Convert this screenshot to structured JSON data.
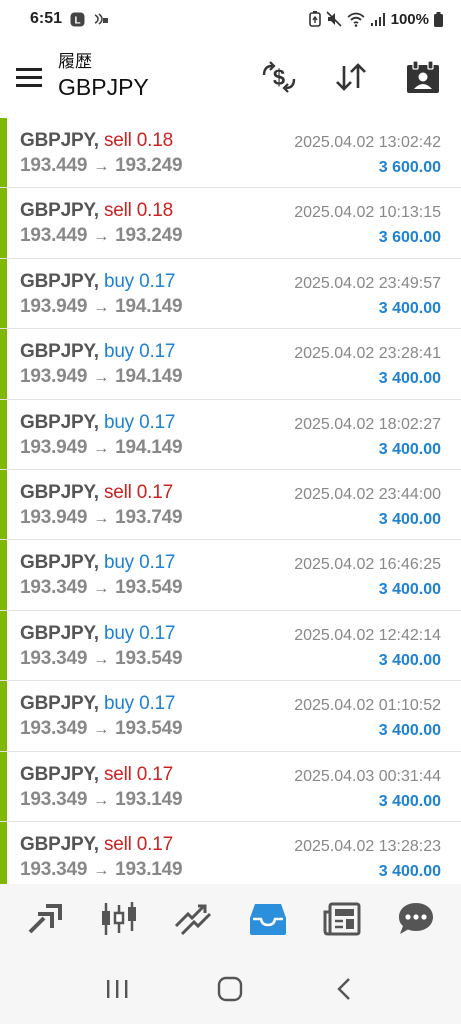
{
  "status_bar": {
    "time": "6:51",
    "battery": "100%",
    "icons": [
      "l-badge-icon",
      "nfc-icon",
      "battery-saver-icon",
      "mute-icon",
      "wifi-icon",
      "signal-icon",
      "battery-icon"
    ]
  },
  "header": {
    "subtitle": "履歴",
    "symbol": "GBPJPY",
    "actions": [
      "currency-exchange-icon",
      "sort-icon",
      "profile-calendar-icon"
    ]
  },
  "trades": [
    {
      "symbol": "GBPJPY,",
      "side": "sell",
      "volume": "0.18",
      "open": "193.449",
      "close": "193.249",
      "datetime": "2025.04.02 13:02:42",
      "profit": "3 600.00"
    },
    {
      "symbol": "GBPJPY,",
      "side": "sell",
      "volume": "0.18",
      "open": "193.449",
      "close": "193.249",
      "datetime": "2025.04.02 10:13:15",
      "profit": "3 600.00"
    },
    {
      "symbol": "GBPJPY,",
      "side": "buy",
      "volume": "0.17",
      "open": "193.949",
      "close": "194.149",
      "datetime": "2025.04.02 23:49:57",
      "profit": "3 400.00"
    },
    {
      "symbol": "GBPJPY,",
      "side": "buy",
      "volume": "0.17",
      "open": "193.949",
      "close": "194.149",
      "datetime": "2025.04.02 23:28:41",
      "profit": "3 400.00"
    },
    {
      "symbol": "GBPJPY,",
      "side": "buy",
      "volume": "0.17",
      "open": "193.949",
      "close": "194.149",
      "datetime": "2025.04.02 18:02:27",
      "profit": "3 400.00"
    },
    {
      "symbol": "GBPJPY,",
      "side": "sell",
      "volume": "0.17",
      "open": "193.949",
      "close": "193.749",
      "datetime": "2025.04.02 23:44:00",
      "profit": "3 400.00"
    },
    {
      "symbol": "GBPJPY,",
      "side": "buy",
      "volume": "0.17",
      "open": "193.349",
      "close": "193.549",
      "datetime": "2025.04.02 16:46:25",
      "profit": "3 400.00"
    },
    {
      "symbol": "GBPJPY,",
      "side": "buy",
      "volume": "0.17",
      "open": "193.349",
      "close": "193.549",
      "datetime": "2025.04.02 12:42:14",
      "profit": "3 400.00"
    },
    {
      "symbol": "GBPJPY,",
      "side": "buy",
      "volume": "0.17",
      "open": "193.349",
      "close": "193.549",
      "datetime": "2025.04.02 01:10:52",
      "profit": "3 400.00"
    },
    {
      "symbol": "GBPJPY,",
      "side": "sell",
      "volume": "0.17",
      "open": "193.349",
      "close": "193.149",
      "datetime": "2025.04.03 00:31:44",
      "profit": "3 400.00"
    },
    {
      "symbol": "GBPJPY,",
      "side": "sell",
      "volume": "0.17",
      "open": "193.349",
      "close": "193.149",
      "datetime": "2025.04.02 13:28:23",
      "profit": "3 400.00"
    }
  ],
  "arrow_glyph": "→",
  "colors": {
    "buy": "#1e82d2",
    "sell": "#cc2222",
    "profit": "#1e82d2",
    "accent_bar": "#7fb800",
    "active_tab": "#2b8fdc"
  },
  "bottom_nav": [
    {
      "name": "quotes-icon",
      "active": false
    },
    {
      "name": "chart-candles-icon",
      "active": false
    },
    {
      "name": "trade-icon",
      "active": false
    },
    {
      "name": "history-inbox-icon",
      "active": true
    },
    {
      "name": "news-icon",
      "active": false
    },
    {
      "name": "chat-icon",
      "active": false
    }
  ],
  "system_nav": [
    "recent-apps-icon",
    "home-icon",
    "back-icon"
  ]
}
